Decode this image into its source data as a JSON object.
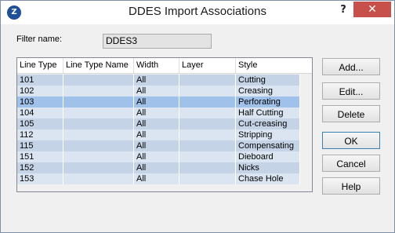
{
  "window": {
    "title": "DDES Import Associations",
    "help_glyph": "?",
    "close_glyph": "✕",
    "app_icon_glyph": "Z"
  },
  "filter": {
    "label": "Filter name:",
    "value": "DDES3"
  },
  "table": {
    "columns": [
      "Line Type",
      "Line Type Name",
      "Width",
      "Layer",
      "Style"
    ],
    "rows": [
      [
        "101",
        "",
        "All",
        "",
        "Cutting"
      ],
      [
        "102",
        "",
        "All",
        "",
        "Creasing"
      ],
      [
        "103",
        "",
        "All",
        "",
        "Perforating"
      ],
      [
        "104",
        "",
        "All",
        "",
        "Half Cutting"
      ],
      [
        "105",
        "",
        "All",
        "",
        "Cut-creasing"
      ],
      [
        "112",
        "",
        "All",
        "",
        "Stripping"
      ],
      [
        "115",
        "",
        "All",
        "",
        "Compensating"
      ],
      [
        "151",
        "",
        "All",
        "",
        "Dieboard"
      ],
      [
        "152",
        "",
        "All",
        "",
        "Nicks"
      ],
      [
        "153",
        "",
        "All",
        "",
        "Chase Hole"
      ]
    ],
    "selected_row": 2
  },
  "buttons": {
    "add": "Add...",
    "edit": "Edit...",
    "delete": "Delete",
    "ok": "OK",
    "cancel": "Cancel",
    "help": "Help"
  },
  "colors": {
    "row_blue": "#c5d3e6",
    "row_light": "#dbe5f2",
    "selected": "#9fc1ea",
    "close_red": "#c7504a",
    "icon_blue": "#1f4f9a"
  }
}
